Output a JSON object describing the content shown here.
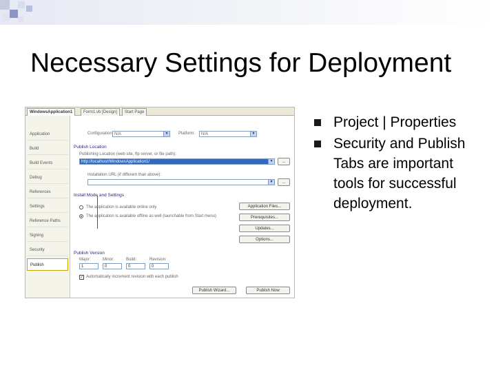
{
  "slide": {
    "title": "Necessary Settings for Deployment",
    "bullets": [
      "Project | Properties",
      "Security and Publish Tabs are important tools for successful deployment."
    ],
    "accent_color": "#2e3a8c"
  },
  "screenshot": {
    "tabs": [
      "WindowsApplication1",
      "Form1.vb [Design]",
      "Start Page"
    ],
    "active_tab": 0,
    "sidebar": {
      "items": [
        "Application",
        "Build",
        "Build Events",
        "Debug",
        "References",
        "Settings",
        "Reference Paths",
        "Signing",
        "Security",
        "Publish"
      ],
      "active": 9
    },
    "configuration_label": "Configuration:",
    "configuration_value": "N/A",
    "platform_label": "Platform:",
    "platform_value": "N/A",
    "publish_location_heading": "Publish Location",
    "publish_location_label": "Publishing Location (web site, ftp server, or file path):",
    "publish_location_value": "http://localhost/WindowsApplication1/",
    "installation_url_label": "Installation URL (if different than above):",
    "install_mode_heading": "Install Mode and Settings",
    "radio_online_only": "The application is available online only",
    "radio_offline": "The application is available offline as well (launchable from Start menu)",
    "buttons": {
      "application_files": "Application Files...",
      "prerequisites": "Prerequisites...",
      "updates": "Updates...",
      "options": "Options...",
      "publish_wizard": "Publish Wizard...",
      "publish_now": "Publish Now",
      "browse": "..."
    },
    "publish_version_heading": "Publish Version",
    "version_labels": [
      "Major:",
      "Minor:",
      "Build:",
      "Revision:"
    ],
    "version_values": [
      "1",
      "0",
      "0",
      "0"
    ],
    "auto_increment_label": "Automatically increment revision with each publish"
  }
}
